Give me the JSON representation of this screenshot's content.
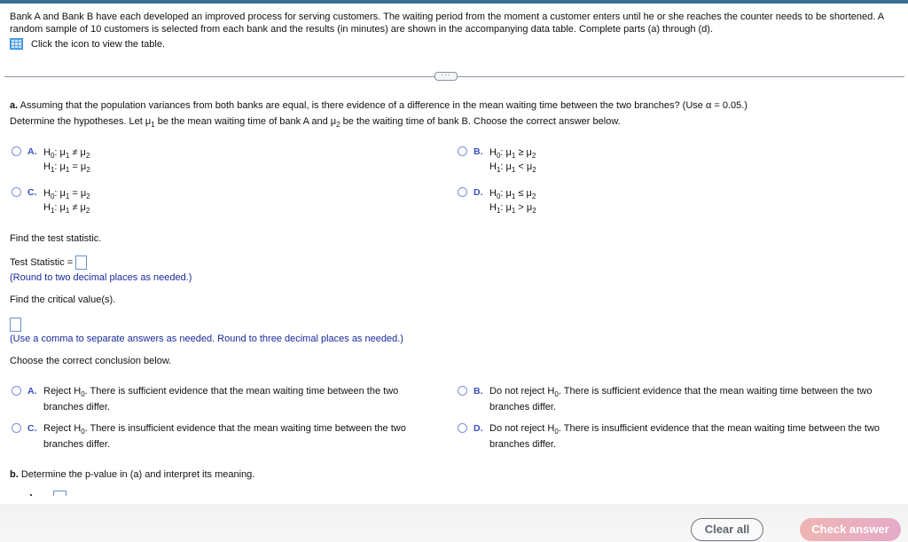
{
  "problem": {
    "intro": "Bank A and Bank B have each developed an improved process for serving customers. The waiting period from the moment a customer enters until he or she reaches the counter needs to be shortened. A random sample of 10 customers is selected from each bank and the results (in minutes) are shown in the accompanying data table. Complete parts (a) through (d).",
    "table_link": "Click the icon to view the table.",
    "table_icon": "grid-table-icon",
    "more_button": "···"
  },
  "part_a": {
    "label": "a.",
    "question": " Assuming that the population variances from both banks are equal, is there evidence of a difference in the mean waiting time between the two branches? (Use α = 0.05.)",
    "hyp_prompt": {
      "p1": "Determine the hypotheses. Let μ",
      "s1": "1",
      "p2": " be the mean waiting time of bank A and μ",
      "s2": "2",
      "p3": " be the waiting time of bank B. Choose the correct answer below."
    },
    "hypothesis_options": [
      {
        "letter": "A.",
        "h0_rel": "≠",
        "h1_rel": "="
      },
      {
        "letter": "B.",
        "h0_rel": "≥",
        "h1_rel": "<"
      },
      {
        "letter": "C.",
        "h0_rel": "=",
        "h1_rel": "≠"
      },
      {
        "letter": "D.",
        "h0_rel": "≤",
        "h1_rel": ">"
      }
    ],
    "hyp_symbols": {
      "H": "H",
      "zero": "0",
      "one": "1",
      "two": "2",
      "mu": "μ",
      "colon": ": "
    },
    "test_stat_prompt": "Find the test statistic.",
    "test_stat_label": "Test Statistic = ",
    "test_stat_value": "",
    "test_stat_hint": "(Round to two decimal places as needed.)",
    "critical_prompt": "Find the critical value(s).",
    "critical_value": "",
    "critical_hint": "(Use a comma to separate answers as needed. Round to three decimal places as needed.)",
    "conclusion_prompt": "Choose the correct conclusion below.",
    "conclusion_options": [
      {
        "letter": "A.",
        "pre": "Reject H",
        "post": ". There is sufficient evidence that the mean waiting time between the two branches differ."
      },
      {
        "letter": "B.",
        "pre": "Do not reject H",
        "post": ". There is sufficient evidence that the mean waiting time between the two branches differ."
      },
      {
        "letter": "C.",
        "pre": "Reject H",
        "post": ". There is insufficient evidence that the mean waiting time between the two branches differ."
      },
      {
        "letter": "D.",
        "pre": "Do not reject H",
        "post": ". There is insufficient evidence that the mean waiting time between the two branches differ."
      }
    ]
  },
  "part_b": {
    "label": "b.",
    "question": " Determine the p-value in (a) and interpret its meaning."
  },
  "footer": {
    "clear_label": "Clear all",
    "check_label": "Check answer"
  },
  "colors": {
    "topbar": "#3a6f95",
    "option_letter": "#3b4fc4",
    "hint_text": "#1a2b9b",
    "check_button": "#e5aac8"
  }
}
